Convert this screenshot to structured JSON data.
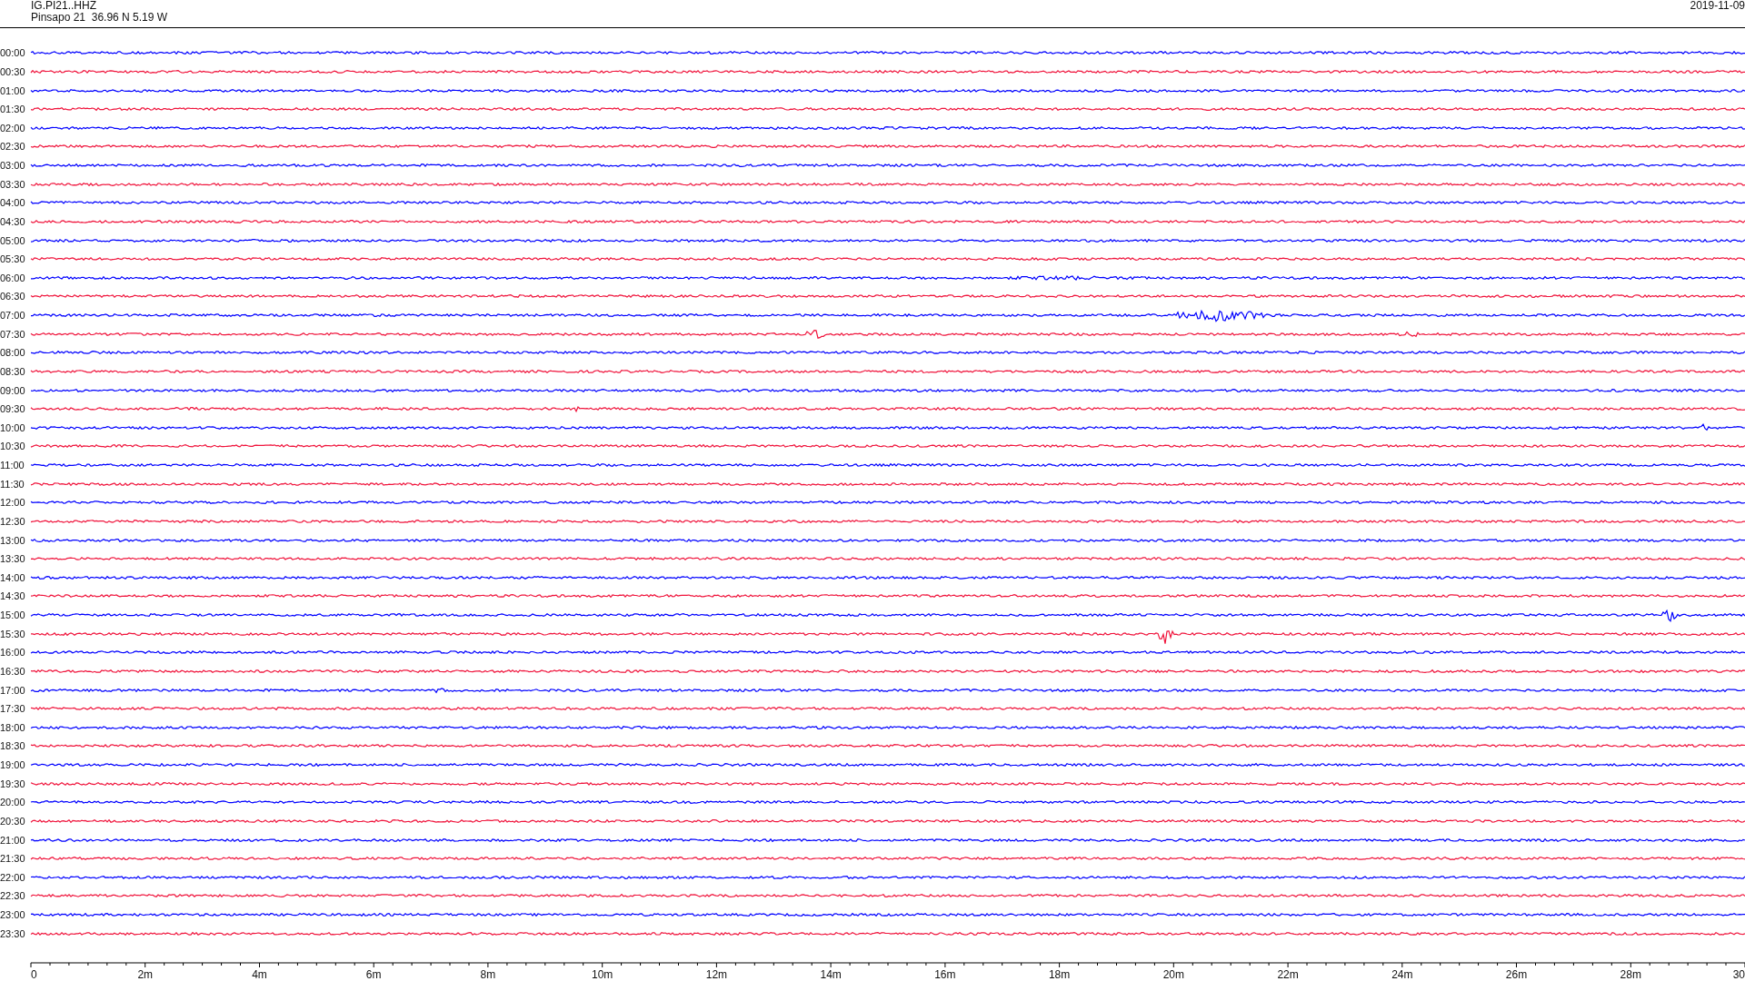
{
  "header": {
    "channel": "IG.PI21..HHZ",
    "station": "Pinsapo 21  36.96 N 5.19 W",
    "date": "2019-11-09"
  },
  "rows": [
    {
      "time": "00:00",
      "color": "#0000ff"
    },
    {
      "time": "00:30",
      "color": "#f0143c"
    },
    {
      "time": "01:00",
      "color": "#0000ff"
    },
    {
      "time": "01:30",
      "color": "#f0143c"
    },
    {
      "time": "02:00",
      "color": "#0000ff"
    },
    {
      "time": "02:30",
      "color": "#f0143c"
    },
    {
      "time": "03:00",
      "color": "#0000ff"
    },
    {
      "time": "03:30",
      "color": "#f0143c"
    },
    {
      "time": "04:00",
      "color": "#0000ff"
    },
    {
      "time": "04:30",
      "color": "#f0143c"
    },
    {
      "time": "05:00",
      "color": "#0000ff"
    },
    {
      "time": "05:30",
      "color": "#f0143c"
    },
    {
      "time": "06:00",
      "color": "#0000ff"
    },
    {
      "time": "06:30",
      "color": "#f0143c"
    },
    {
      "time": "07:00",
      "color": "#0000ff"
    },
    {
      "time": "07:30",
      "color": "#f0143c"
    },
    {
      "time": "08:00",
      "color": "#0000ff"
    },
    {
      "time": "08:30",
      "color": "#f0143c"
    },
    {
      "time": "09:00",
      "color": "#0000ff"
    },
    {
      "time": "09:30",
      "color": "#f0143c"
    },
    {
      "time": "10:00",
      "color": "#0000ff"
    },
    {
      "time": "10:30",
      "color": "#f0143c"
    },
    {
      "time": "11:00",
      "color": "#0000ff"
    },
    {
      "time": "11:30",
      "color": "#f0143c"
    },
    {
      "time": "12:00",
      "color": "#0000ff"
    },
    {
      "time": "12:30",
      "color": "#f0143c"
    },
    {
      "time": "13:00",
      "color": "#0000ff"
    },
    {
      "time": "13:30",
      "color": "#f0143c"
    },
    {
      "time": "14:00",
      "color": "#0000ff"
    },
    {
      "time": "14:30",
      "color": "#f0143c"
    },
    {
      "time": "15:00",
      "color": "#0000ff"
    },
    {
      "time": "15:30",
      "color": "#f0143c"
    },
    {
      "time": "16:00",
      "color": "#0000ff"
    },
    {
      "time": "16:30",
      "color": "#f0143c"
    },
    {
      "time": "17:00",
      "color": "#0000ff"
    },
    {
      "time": "17:30",
      "color": "#f0143c"
    },
    {
      "time": "18:00",
      "color": "#0000ff"
    },
    {
      "time": "18:30",
      "color": "#f0143c"
    },
    {
      "time": "19:00",
      "color": "#0000ff"
    },
    {
      "time": "19:30",
      "color": "#f0143c"
    },
    {
      "time": "20:00",
      "color": "#0000ff"
    },
    {
      "time": "20:30",
      "color": "#f0143c"
    },
    {
      "time": "21:00",
      "color": "#0000ff"
    },
    {
      "time": "21:30",
      "color": "#f0143c"
    },
    {
      "time": "22:00",
      "color": "#0000ff"
    },
    {
      "time": "22:30",
      "color": "#f0143c"
    },
    {
      "time": "23:00",
      "color": "#0000ff"
    },
    {
      "time": "23:30",
      "color": "#f0143c"
    }
  ],
  "axis_labels": [
    "0",
    "2m",
    "4m",
    "6m",
    "8m",
    "10m",
    "12m",
    "14m",
    "16m",
    "18m",
    "20m",
    "22m",
    "24m",
    "26m",
    "28m",
    "30"
  ]
}
